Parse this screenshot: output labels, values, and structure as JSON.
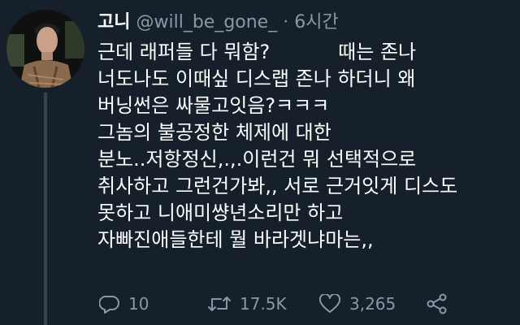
{
  "tweet": {
    "display_name": "고니",
    "handle": "@will_be_gone_",
    "separator": "·",
    "time": "6시간",
    "lines": [
      "근데 래퍼들 다 뭐함?           때는 존나",
      "너도나도 이때싶 디스랩 존나 하더니 왜",
      "버닝썬은 싸물고잇음?ㅋㅋㅋ",
      "그놈의 불공정한 체제에 대한",
      "분노..저항정신,.,.이런건 뭐 선택적으로",
      "취사하고 그런건가봐,, 서로 근거잇게 디스도",
      "못하고 니애미썅년소리만 하고",
      "자빠진애들한테 뭘 바라겟냐마는,,"
    ]
  },
  "actions": {
    "reply_count": "10",
    "retweet_count": "17.5K",
    "like_count": "3,265"
  },
  "icons": {
    "reply": "reply-icon",
    "retweet": "retweet-icon",
    "like": "heart-icon",
    "share": "share-icon"
  },
  "colors": {
    "background": "#15202b",
    "secondary_text": "#8899a6",
    "thread_line": "#38444d"
  }
}
